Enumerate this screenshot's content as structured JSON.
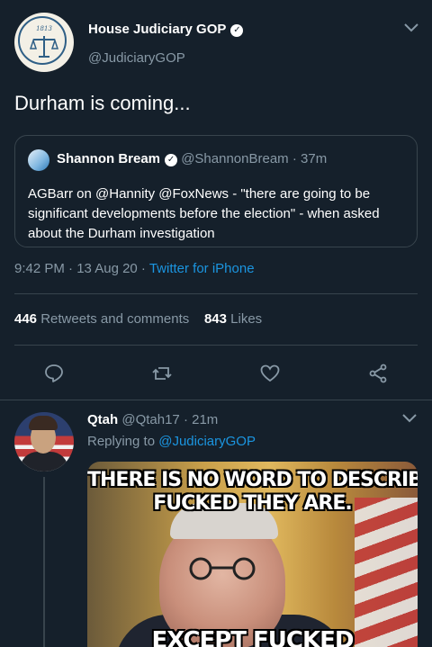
{
  "tweet": {
    "author_name": "House Judiciary GOP",
    "author_handle": "@JudiciaryGOP",
    "seal_year": "1813",
    "text": "Durham is coming...",
    "quoted": {
      "name": "Shannon Bream",
      "handle": "@ShannonBream",
      "time": "· 37m",
      "text": "AGBarr on @Hannity @FoxNews - \"there are going to be significant developments before the election\" - when asked about the Durham investigation"
    },
    "time": "9:42 PM · 13 Aug 20 ·",
    "client": "Twitter for iPhone",
    "retweets_count": "446",
    "retweets_label": "Retweets and comments",
    "likes_count": "843",
    "likes_label": "Likes"
  },
  "icons": [
    "reply-icon",
    "retweet-icon",
    "like-icon",
    "share-icon",
    "chevron-down-icon",
    "verified-icon"
  ],
  "reply": {
    "name": "Qtah",
    "handle": "@Qtah17",
    "time": "· 21m",
    "replying_prefix": "Replying to",
    "replying_to": "@JudiciaryGOP",
    "image_text_top_1": "THERE IS NO WORD TO DESCRIBE HOW",
    "image_text_top_2": "FUCKED THEY ARE.",
    "image_text_bottom": "EXCEPT FUCKED"
  },
  "colors": {
    "background": "#15202b",
    "muted": "#8899a6",
    "link": "#1b95e0",
    "divider": "#38444d"
  }
}
